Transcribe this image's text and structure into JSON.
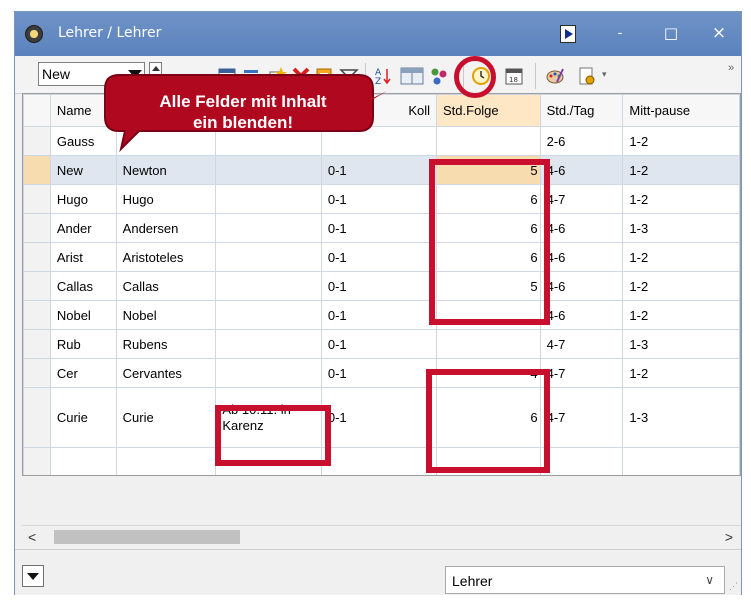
{
  "window": {
    "title": "Lehrer / Lehrer",
    "minimize_label": "-",
    "maximize_label": "□",
    "close_label": "×"
  },
  "toolbar": {
    "combo_value": "New",
    "overflow_label": "»"
  },
  "callout": {
    "line1": "Alle Felder mit Inhalt",
    "line2": "ein blenden!"
  },
  "table": {
    "columns": [
      "",
      "Name",
      "",
      "",
      "Koll",
      "Std.Folge",
      "Std./Tag",
      "Mitt-pause"
    ],
    "rows": [
      {
        "name": "Gauss",
        "full": "",
        "text": "",
        "koll": "",
        "folge": "",
        "tag": "2-6",
        "mitt": "1-2"
      },
      {
        "name": "New",
        "full": "Newton",
        "text": "",
        "koll": "0-1",
        "folge": "5",
        "tag": "4-6",
        "mitt": "1-2"
      },
      {
        "name": "Hugo",
        "full": "Hugo",
        "text": "",
        "koll": "0-1",
        "folge": "6",
        "tag": "4-7",
        "mitt": "1-2"
      },
      {
        "name": "Ander",
        "full": "Andersen",
        "text": "",
        "koll": "0-1",
        "folge": "6",
        "tag": "4-6",
        "mitt": "1-3"
      },
      {
        "name": "Arist",
        "full": "Aristoteles",
        "text": "",
        "koll": "0-1",
        "folge": "6",
        "tag": "4-6",
        "mitt": "1-2"
      },
      {
        "name": "Callas",
        "full": "Callas",
        "text": "",
        "koll": "0-1",
        "folge": "5",
        "tag": "4-6",
        "mitt": "1-2"
      },
      {
        "name": "Nobel",
        "full": "Nobel",
        "text": "",
        "koll": "0-1",
        "folge": "",
        "tag": "4-6",
        "mitt": "1-2"
      },
      {
        "name": "Rub",
        "full": "Rubens",
        "text": "",
        "koll": "0-1",
        "folge": "",
        "tag": "4-7",
        "mitt": "1-3"
      },
      {
        "name": "Cer",
        "full": "Cervantes",
        "text": "",
        "koll": "0-1",
        "folge": "4",
        "tag": "4-7",
        "mitt": "1-2"
      },
      {
        "name": "Curie",
        "full": "Curie",
        "text": "Ab 10.11. in Karenz",
        "koll": "0-1",
        "folge": "6",
        "tag": "4-7",
        "mitt": "1-3"
      }
    ]
  },
  "scroll": {
    "left_arrow": "<",
    "right_arrow": ">"
  },
  "bottom": {
    "select_value": "Lehrer",
    "select_arrow": "∨"
  },
  "colors": {
    "accent_red": "#c8102e",
    "titlebar": "#5b82bd",
    "selected_row": "#dfe6f0",
    "highlight": "#f7dcb0"
  }
}
